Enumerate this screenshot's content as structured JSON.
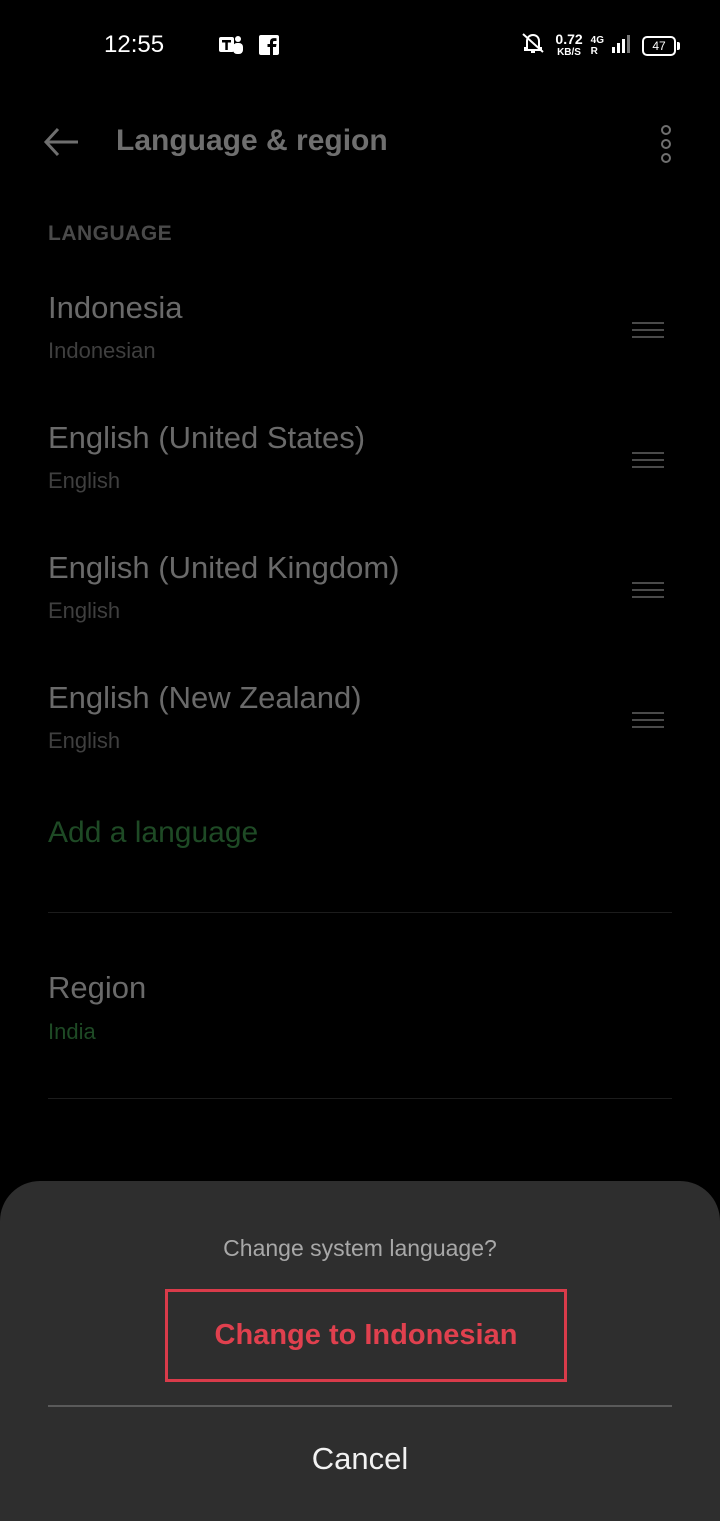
{
  "status_bar": {
    "time": "12:55",
    "notification_icons": [
      "teams-icon",
      "facebook-icon"
    ],
    "net_speed": "0.72",
    "net_unit": "KB/S",
    "network_top": "4G",
    "network_bottom": "R",
    "battery": "47"
  },
  "header": {
    "title": "Language & region"
  },
  "language_section": {
    "label": "LANGUAGE",
    "items": [
      {
        "name": "Indonesia",
        "sub": "Indonesian"
      },
      {
        "name": "English (United States)",
        "sub": "English"
      },
      {
        "name": "English (United Kingdom)",
        "sub": "English"
      },
      {
        "name": "English (New Zealand)",
        "sub": "English"
      }
    ],
    "add_label": "Add a language"
  },
  "region": {
    "title": "Region",
    "value": "India"
  },
  "dialog": {
    "prompt": "Change system language?",
    "confirm_label": "Change to Indonesian",
    "cancel_label": "Cancel"
  },
  "colors": {
    "background": "#000000",
    "sheet": "#2e2e2e",
    "accent_green": "#1e4a25",
    "highlight_red": "#d93b4a"
  }
}
